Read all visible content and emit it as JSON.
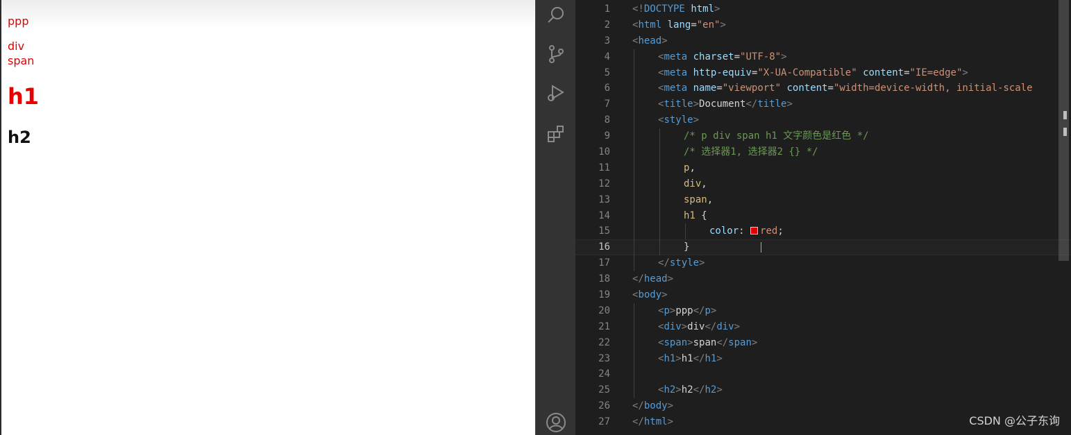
{
  "preview": {
    "p_text": "ppp",
    "div_text": "div",
    "span_text": "span",
    "h1_text": "h1",
    "h2_text": "h2",
    "accent_color": "#e60000"
  },
  "activity_bar": {
    "icons": [
      "search-icon",
      "source-control-icon",
      "run-debug-icon",
      "extensions-icon",
      "account-icon"
    ]
  },
  "editor": {
    "active_line": 16,
    "lines": [
      {
        "n": "1",
        "indent": 0,
        "tokens": [
          [
            "br",
            "<!"
          ],
          [
            "tag",
            "DOCTYPE"
          ],
          [
            "txt",
            " "
          ],
          [
            "attr",
            "html"
          ],
          [
            "br",
            ">"
          ]
        ]
      },
      {
        "n": "2",
        "indent": 0,
        "tokens": [
          [
            "br",
            "<"
          ],
          [
            "tag",
            "html"
          ],
          [
            "txt",
            " "
          ],
          [
            "attr",
            "lang"
          ],
          [
            "txt",
            "="
          ],
          [
            "val",
            "\"en\""
          ],
          [
            "br",
            ">"
          ]
        ]
      },
      {
        "n": "3",
        "indent": 0,
        "tokens": [
          [
            "br",
            "<"
          ],
          [
            "tag",
            "head"
          ],
          [
            "br",
            ">"
          ]
        ]
      },
      {
        "n": "4",
        "indent": 1,
        "tokens": [
          [
            "br",
            "<"
          ],
          [
            "tag",
            "meta"
          ],
          [
            "txt",
            " "
          ],
          [
            "attr",
            "charset"
          ],
          [
            "txt",
            "="
          ],
          [
            "val",
            "\"UTF-8\""
          ],
          [
            "br",
            ">"
          ]
        ]
      },
      {
        "n": "5",
        "indent": 1,
        "tokens": [
          [
            "br",
            "<"
          ],
          [
            "tag",
            "meta"
          ],
          [
            "txt",
            " "
          ],
          [
            "attr",
            "http-equiv"
          ],
          [
            "txt",
            "="
          ],
          [
            "val",
            "\"X-UA-Compatible\""
          ],
          [
            "txt",
            " "
          ],
          [
            "attr",
            "content"
          ],
          [
            "txt",
            "="
          ],
          [
            "val",
            "\"IE=edge\""
          ],
          [
            "br",
            ">"
          ]
        ]
      },
      {
        "n": "6",
        "indent": 1,
        "tokens": [
          [
            "br",
            "<"
          ],
          [
            "tag",
            "meta"
          ],
          [
            "txt",
            " "
          ],
          [
            "attr",
            "name"
          ],
          [
            "txt",
            "="
          ],
          [
            "val",
            "\"viewport\""
          ],
          [
            "txt",
            " "
          ],
          [
            "attr",
            "content"
          ],
          [
            "txt",
            "="
          ],
          [
            "val",
            "\"width=device-width, initial-scale"
          ]
        ]
      },
      {
        "n": "7",
        "indent": 1,
        "tokens": [
          [
            "br",
            "<"
          ],
          [
            "tag",
            "title"
          ],
          [
            "br",
            ">"
          ],
          [
            "txt",
            "Document"
          ],
          [
            "br",
            "</"
          ],
          [
            "tag",
            "title"
          ],
          [
            "br",
            ">"
          ]
        ]
      },
      {
        "n": "8",
        "indent": 1,
        "tokens": [
          [
            "br",
            "<"
          ],
          [
            "tag",
            "style"
          ],
          [
            "br",
            ">"
          ]
        ]
      },
      {
        "n": "9",
        "indent": 2,
        "tokens": [
          [
            "cmt",
            "/* p div span h1 文字颜色是红色 */"
          ]
        ]
      },
      {
        "n": "10",
        "indent": 2,
        "tokens": [
          [
            "cmt",
            "/* 选择器1, 选择器2 {} */"
          ]
        ]
      },
      {
        "n": "11",
        "indent": 2,
        "tokens": [
          [
            "sel",
            "p"
          ],
          [
            "txt",
            ","
          ]
        ]
      },
      {
        "n": "12",
        "indent": 2,
        "tokens": [
          [
            "sel",
            "div"
          ],
          [
            "txt",
            ","
          ]
        ]
      },
      {
        "n": "13",
        "indent": 2,
        "tokens": [
          [
            "sel",
            "span"
          ],
          [
            "txt",
            ","
          ]
        ]
      },
      {
        "n": "14",
        "indent": 2,
        "tokens": [
          [
            "sel",
            "h1"
          ],
          [
            "txt",
            " {"
          ]
        ]
      },
      {
        "n": "15",
        "indent": 3,
        "tokens": [
          [
            "prop",
            "color"
          ],
          [
            "txt",
            ": "
          ],
          [
            "swatch",
            "#e00000"
          ],
          [
            "val",
            "red"
          ],
          [
            "txt",
            ";"
          ]
        ]
      },
      {
        "n": "16",
        "indent": 2,
        "tokens": [
          [
            "txt",
            "}"
          ]
        ]
      },
      {
        "n": "17",
        "indent": 1,
        "tokens": [
          [
            "br",
            "</"
          ],
          [
            "tag",
            "style"
          ],
          [
            "br",
            ">"
          ]
        ]
      },
      {
        "n": "18",
        "indent": 0,
        "tokens": [
          [
            "br",
            "</"
          ],
          [
            "tag",
            "head"
          ],
          [
            "br",
            ">"
          ]
        ]
      },
      {
        "n": "19",
        "indent": 0,
        "tokens": [
          [
            "br",
            "<"
          ],
          [
            "tag",
            "body"
          ],
          [
            "br",
            ">"
          ]
        ]
      },
      {
        "n": "20",
        "indent": 1,
        "tokens": [
          [
            "br",
            "<"
          ],
          [
            "tag",
            "p"
          ],
          [
            "br",
            ">"
          ],
          [
            "txt",
            "ppp"
          ],
          [
            "br",
            "</"
          ],
          [
            "tag",
            "p"
          ],
          [
            "br",
            ">"
          ]
        ]
      },
      {
        "n": "21",
        "indent": 1,
        "tokens": [
          [
            "br",
            "<"
          ],
          [
            "tag",
            "div"
          ],
          [
            "br",
            ">"
          ],
          [
            "txt",
            "div"
          ],
          [
            "br",
            "</"
          ],
          [
            "tag",
            "div"
          ],
          [
            "br",
            ">"
          ]
        ]
      },
      {
        "n": "22",
        "indent": 1,
        "tokens": [
          [
            "br",
            "<"
          ],
          [
            "tag",
            "span"
          ],
          [
            "br",
            ">"
          ],
          [
            "txt",
            "span"
          ],
          [
            "br",
            "</"
          ],
          [
            "tag",
            "span"
          ],
          [
            "br",
            ">"
          ]
        ]
      },
      {
        "n": "23",
        "indent": 1,
        "tokens": [
          [
            "br",
            "<"
          ],
          [
            "tag",
            "h1"
          ],
          [
            "br",
            ">"
          ],
          [
            "txt",
            "h1"
          ],
          [
            "br",
            "</"
          ],
          [
            "tag",
            "h1"
          ],
          [
            "br",
            ">"
          ]
        ]
      },
      {
        "n": "24",
        "indent": 0,
        "tokens": []
      },
      {
        "n": "25",
        "indent": 1,
        "tokens": [
          [
            "br",
            "<"
          ],
          [
            "tag",
            "h2"
          ],
          [
            "br",
            ">"
          ],
          [
            "txt",
            "h2"
          ],
          [
            "br",
            "</"
          ],
          [
            "tag",
            "h2"
          ],
          [
            "br",
            ">"
          ]
        ]
      },
      {
        "n": "26",
        "indent": 0,
        "tokens": [
          [
            "br",
            "</"
          ],
          [
            "tag",
            "body"
          ],
          [
            "br",
            ">"
          ]
        ]
      },
      {
        "n": "27",
        "indent": 0,
        "tokens": [
          [
            "br",
            "</"
          ],
          [
            "tag",
            "html"
          ],
          [
            "br",
            ">"
          ]
        ]
      }
    ]
  },
  "watermark": "CSDN @公子东询"
}
